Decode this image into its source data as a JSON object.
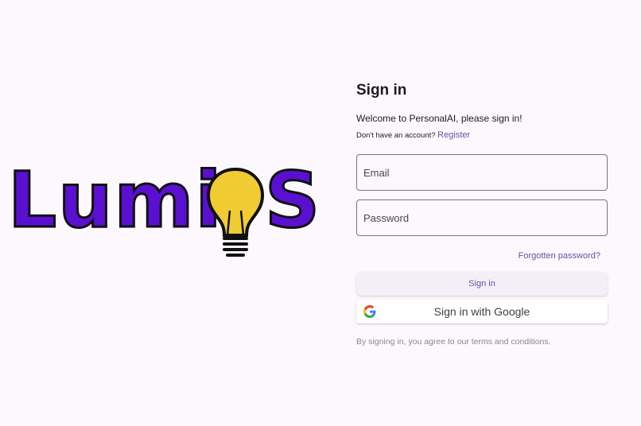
{
  "logo": {
    "left_text": "Lumi",
    "right_text": "S",
    "brand_color": "#5a10d0",
    "bulb_color": "#f0cc32",
    "icon": "lightbulb-icon"
  },
  "form": {
    "title": "Sign in",
    "welcome": "Welcome to PersonalAI, please sign in!",
    "no_account_text": "Don't have an account?",
    "register_label": "Register",
    "email_placeholder": "Email",
    "password_placeholder": "Password",
    "forgot_label": "Forgotten password?",
    "signin_label": "Sign in",
    "google_label": "Sign in with Google",
    "terms": "By signing in, you agree to our terms and conditions.",
    "accent_color": "#6750a4"
  }
}
